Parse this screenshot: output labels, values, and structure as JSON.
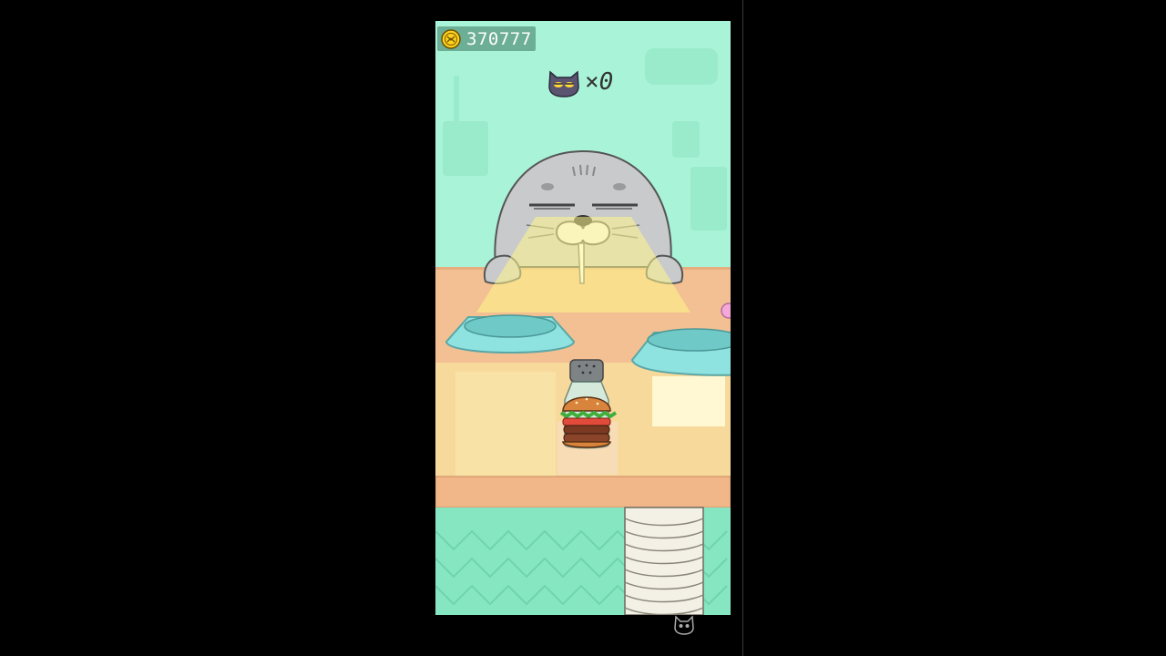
{
  "hud": {
    "coins": "370777",
    "cat_count": "×0"
  },
  "colors": {
    "wall": "#a9f4d8",
    "counter": "#f2c092",
    "floor": "#86e6c2",
    "seal": "#c9cacb",
    "bowl": "#8ee3e1",
    "beam": "#fff58a"
  },
  "icons": {
    "coin": "coin-icon",
    "cat": "cat-face-icon",
    "corner": "cat-head-icon"
  }
}
